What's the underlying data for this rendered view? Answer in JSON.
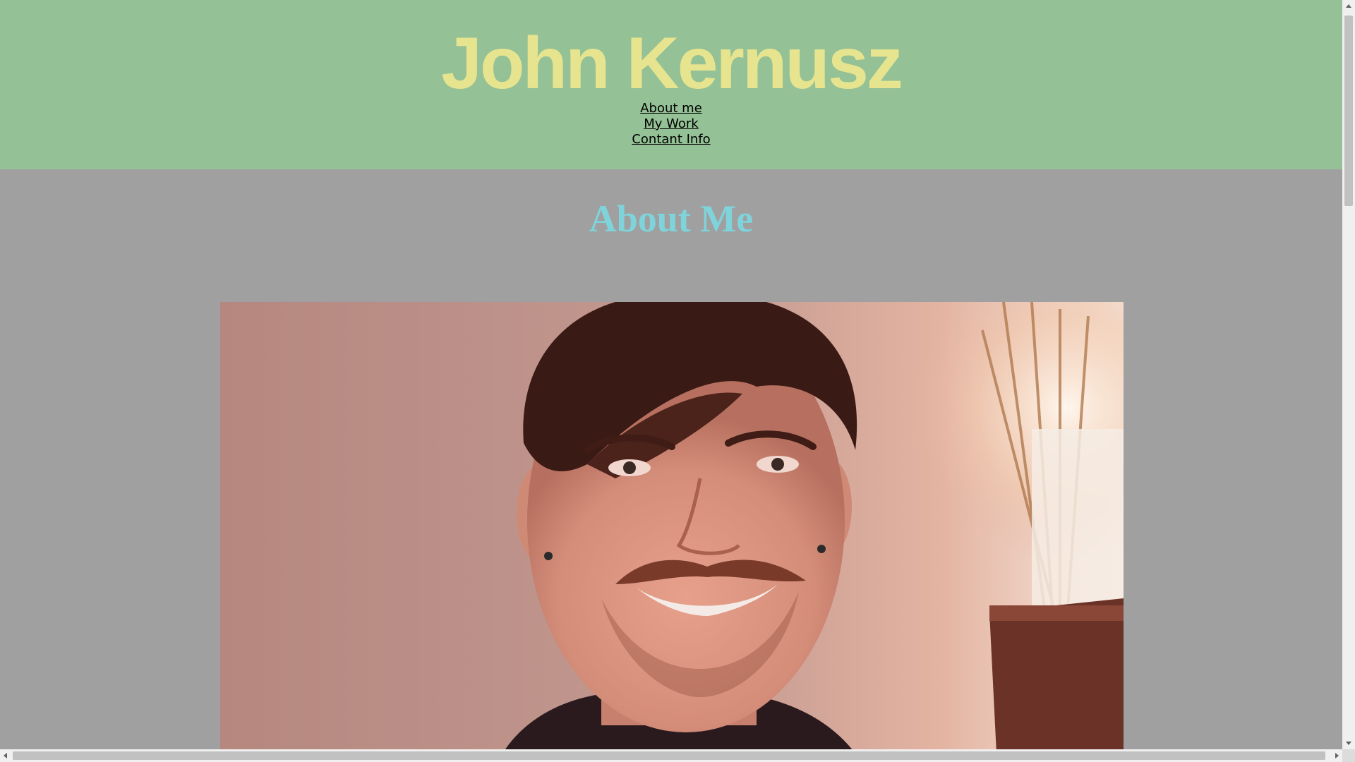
{
  "header": {
    "title": "John Kernusz",
    "nav": [
      {
        "label": "About me"
      },
      {
        "label": "My Work"
      },
      {
        "label": "Contant Info"
      }
    ]
  },
  "main": {
    "section_heading": "About Me",
    "photo_alt": "Portrait photo"
  },
  "colors": {
    "header_bg": "#94c195",
    "title": "#e7e48f",
    "page_bg": "#a0a0a0",
    "section_heading": "#7fd3db"
  }
}
